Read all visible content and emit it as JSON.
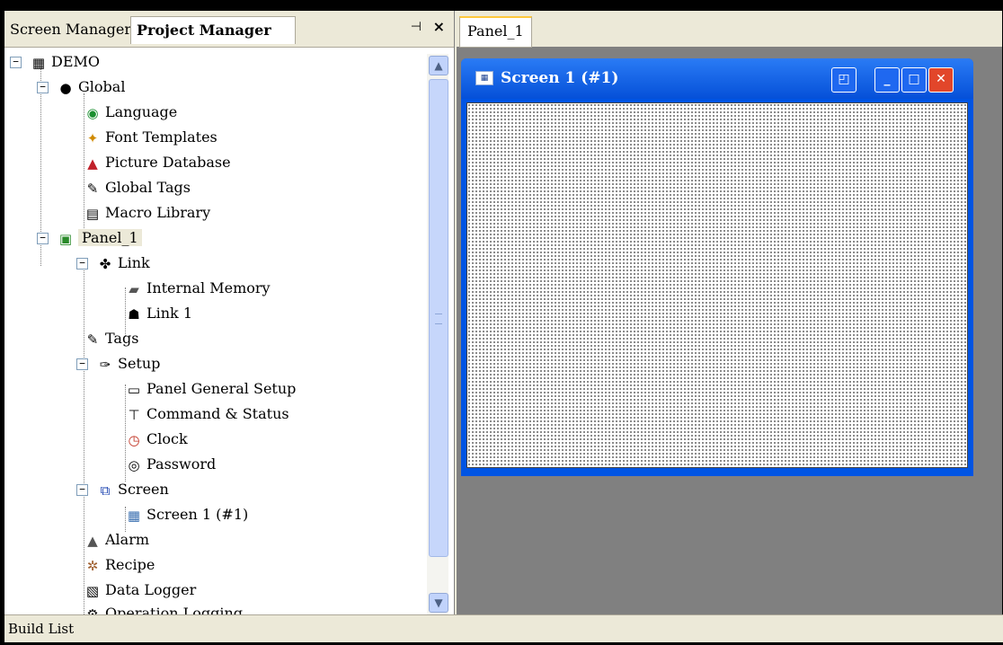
{
  "left_panel": {
    "tabs": [
      "Screen Manager",
      "Project Manager"
    ],
    "pin_glyph": "⊣",
    "close_glyph": "×"
  },
  "tree": [
    {
      "label": "DEMO",
      "icon": "project-icon",
      "glyph": "▦"
    },
    {
      "label": "Global",
      "icon": "globe-icon",
      "glyph": "●"
    },
    {
      "label": "Language",
      "icon": "language-globe-icon",
      "glyph": "◉"
    },
    {
      "label": "Font Templates",
      "icon": "font-templates-icon",
      "glyph": "✦"
    },
    {
      "label": "Picture Database",
      "icon": "picture-database-icon",
      "glyph": "▲"
    },
    {
      "label": "Global Tags",
      "icon": "tags-icon",
      "glyph": "✎"
    },
    {
      "label": "Macro Library",
      "icon": "macro-library-icon",
      "glyph": "▤"
    },
    {
      "label": "Panel_1",
      "icon": "panel-icon",
      "glyph": "▣"
    },
    {
      "label": "Link",
      "icon": "link-icon",
      "glyph": "✤"
    },
    {
      "label": "Internal Memory",
      "icon": "memory-chip-icon",
      "glyph": "▰"
    },
    {
      "label": "Link 1",
      "icon": "link-device-icon",
      "glyph": "☗"
    },
    {
      "label": "Tags",
      "icon": "tags-icon",
      "glyph": "✎"
    },
    {
      "label": "Setup",
      "icon": "setup-wrench-icon",
      "glyph": "✑"
    },
    {
      "label": "Panel General Setup",
      "icon": "panel-setup-icon",
      "glyph": "▭"
    },
    {
      "label": "Command & Status",
      "icon": "command-status-icon",
      "glyph": "⊤"
    },
    {
      "label": "Clock",
      "icon": "clock-icon",
      "glyph": "◷"
    },
    {
      "label": "Password",
      "icon": "password-icon",
      "glyph": "◎"
    },
    {
      "label": "Screen",
      "icon": "screen-icon",
      "glyph": "⧉"
    },
    {
      "label": "Screen 1 (#1)",
      "icon": "screen-page-icon",
      "glyph": "▦"
    },
    {
      "label": "Alarm",
      "icon": "alarm-bell-icon",
      "glyph": "▲"
    },
    {
      "label": "Recipe",
      "icon": "recipe-icon",
      "glyph": "✲"
    },
    {
      "label": "Data Logger",
      "icon": "data-logger-icon",
      "glyph": "▧"
    },
    {
      "label": "Operation Logging",
      "icon": "operation-logging-icon",
      "glyph": "⚙"
    }
  ],
  "scrollbar": {
    "up": "▲",
    "down": "▼"
  },
  "document": {
    "tab": "Panel_1",
    "window_title": "Screen 1 (#1)",
    "window_icon": "▦",
    "buttons": {
      "restore_alt": "◰",
      "minimize": "_",
      "maximize": "□",
      "close": "✕"
    }
  },
  "status_bar": "Build List",
  "colors": {
    "title_bar": "#0054e3",
    "close_button": "#e2462a",
    "workspace": "#808080"
  }
}
